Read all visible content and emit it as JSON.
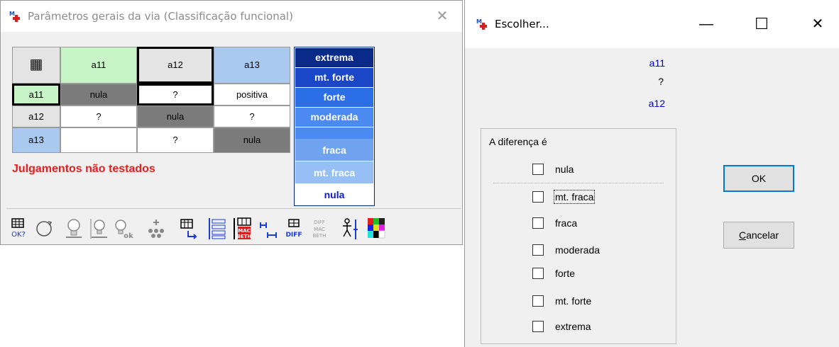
{
  "win1": {
    "title": "Parâmetros gerais da via (Classificação funcional)",
    "close_glyph": "✕",
    "calc_glyph": "▦",
    "headers": [
      "a11",
      "a12",
      "a13"
    ],
    "rows": [
      {
        "label": "a11",
        "cells": [
          "nula",
          "?",
          "positiva"
        ]
      },
      {
        "label": "a12",
        "cells": [
          "?",
          "nula",
          "?"
        ]
      },
      {
        "label": "a13",
        "cells": [
          "",
          "?",
          "nula"
        ]
      }
    ],
    "scale": [
      {
        "label": "extrema",
        "color": "#0a2a8a"
      },
      {
        "label": "mt. forte",
        "color": "#1a46c8"
      },
      {
        "label": "forte",
        "color": "#2c6ee6"
      },
      {
        "label": "moderada",
        "color": "#4b8af0"
      },
      {
        "label": "fraca",
        "color": "#6fa2ef"
      },
      {
        "label": "mt. fraca",
        "color": "#96c0f5"
      },
      {
        "label": "nula",
        "color": "#ffffff"
      }
    ],
    "warning": "Julgamentos não testados",
    "toolbar_icons": [
      "matrix-ok-icon",
      "refresh-icon",
      "bulb-icon",
      "bulb-bar-icon",
      "bulb-ok-icon",
      "graph-icon",
      "matrix-arrow-icon",
      "list-icon",
      "macbeth-matrix-icon",
      "interval-icon",
      "diff-icon",
      "diff-macbeth-icon",
      "walker-icon",
      "palette-icon"
    ],
    "toolbar_texts": {
      "ok": "OK?",
      "diff": "DIFF",
      "mac": "MAC",
      "beth": "BETH"
    }
  },
  "win2": {
    "title": "Escolher...",
    "min_glyph": "—",
    "max_glyph": "☐",
    "close_glyph": "✕",
    "pair_top": "a11",
    "pair_mid": "?",
    "pair_bottom": "a12",
    "group_label": "A diferença é",
    "options": [
      "nula",
      "mt. fraca",
      "fraca",
      "moderada",
      "forte",
      "mt. forte",
      "extrema"
    ],
    "ok": "OK",
    "cancel_pre": "",
    "cancel_ul": "C",
    "cancel_post": "ancelar"
  },
  "colors": {
    "warning": "#e81e1e",
    "pair_text": "#0000cc",
    "green_cell": "#c8f5c8",
    "blue_cell": "#a9c9ef",
    "gray_cell": "#7b7b7b",
    "ok_focus": "#0078d7"
  }
}
